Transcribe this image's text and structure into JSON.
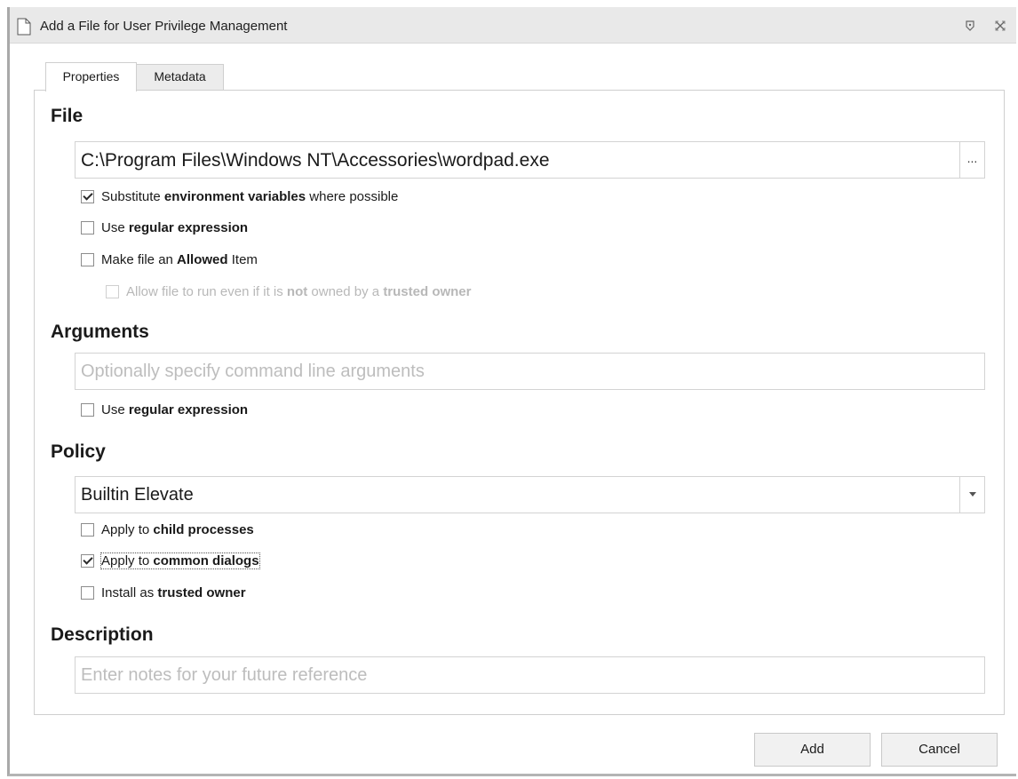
{
  "window": {
    "title": "Add a File for User Privilege Management"
  },
  "tabs": [
    {
      "label": "Properties",
      "active": true
    },
    {
      "label": "Metadata",
      "active": false
    }
  ],
  "file": {
    "heading": "File",
    "path_value": "C:\\Program Files\\Windows NT\\Accessories\\wordpad.exe",
    "browse_label": "...",
    "options": {
      "substitute_env": {
        "prefix": "Substitute ",
        "bold": "environment variables",
        "suffix": " where possible",
        "checked": true
      },
      "use_regex": {
        "prefix": "Use ",
        "bold": "regular expression",
        "suffix": "",
        "checked": false
      },
      "allowed_item": {
        "prefix": "Make file an ",
        "bold": "Allowed",
        "suffix": " Item",
        "checked": false
      },
      "trusted_owner_run": {
        "prefix": "Allow file to run even if it is ",
        "bold": "not",
        "middle": " owned by a ",
        "bold2": "trusted owner",
        "checked": false,
        "disabled": true
      }
    }
  },
  "arguments": {
    "heading": "Arguments",
    "placeholder": "Optionally specify command line arguments",
    "use_regex": {
      "prefix": "Use ",
      "bold": "regular expression",
      "checked": false
    }
  },
  "policy": {
    "heading": "Policy",
    "selected": "Builtin Elevate",
    "options": {
      "child_processes": {
        "prefix": "Apply to ",
        "bold": "child processes",
        "checked": false
      },
      "common_dialogs": {
        "prefix": "Apply to ",
        "bold": "common dialogs",
        "checked": true
      },
      "trusted_owner": {
        "prefix": "Install as ",
        "bold": "trusted owner",
        "checked": false
      }
    }
  },
  "description": {
    "heading": "Description",
    "placeholder": "Enter notes for your future reference"
  },
  "buttons": {
    "add": "Add",
    "cancel": "Cancel"
  },
  "icons": {
    "title_doc": "document-icon",
    "title_help": "help-icon",
    "title_close": "close-icon",
    "combo_arrow": "chevron-down-icon"
  }
}
